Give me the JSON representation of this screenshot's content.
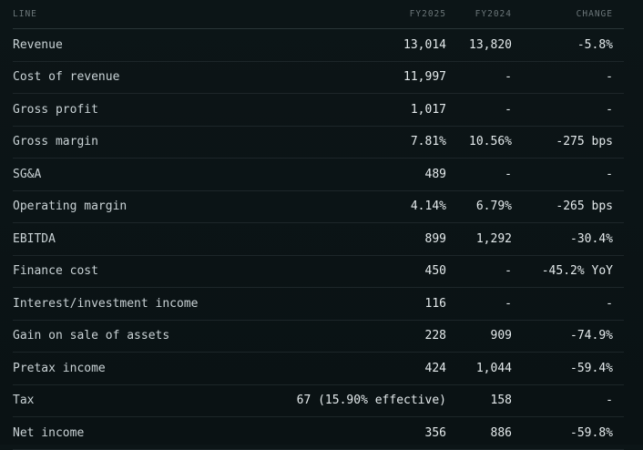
{
  "columns": {
    "line": "LINE",
    "fy2025": "FY2025",
    "fy2024": "FY2024",
    "change": "CHANGE"
  },
  "rows": [
    {
      "line": "Revenue",
      "fy2025": "13,014",
      "fy2024": "13,820",
      "change": "-5.8%"
    },
    {
      "line": "Cost of revenue",
      "fy2025": "11,997",
      "fy2024": "-",
      "change": "-"
    },
    {
      "line": "Gross profit",
      "fy2025": "1,017",
      "fy2024": "-",
      "change": "-"
    },
    {
      "line": "Gross margin",
      "fy2025": "7.81%",
      "fy2024": "10.56%",
      "change": "-275 bps"
    },
    {
      "line": "SG&A",
      "fy2025": "489",
      "fy2024": "-",
      "change": "-"
    },
    {
      "line": "Operating margin",
      "fy2025": "4.14%",
      "fy2024": "6.79%",
      "change": "-265 bps"
    },
    {
      "line": "EBITDA",
      "fy2025": "899",
      "fy2024": "1,292",
      "change": "-30.4%"
    },
    {
      "line": "Finance cost",
      "fy2025": "450",
      "fy2024": "-",
      "change": "-45.2% YoY"
    },
    {
      "line": "Interest/investment income",
      "fy2025": "116",
      "fy2024": "-",
      "change": "-"
    },
    {
      "line": "Gain on sale of assets",
      "fy2025": "228",
      "fy2024": "909",
      "change": "-74.9%"
    },
    {
      "line": "Pretax income",
      "fy2025": "424",
      "fy2024": "1,044",
      "change": "-59.4%"
    },
    {
      "line": "Tax",
      "fy2025": "67 (15.90% effective)",
      "fy2024": "158",
      "change": "-"
    },
    {
      "line": "Net income",
      "fy2025": "356",
      "fy2024": "886",
      "change": "-59.8%"
    }
  ]
}
